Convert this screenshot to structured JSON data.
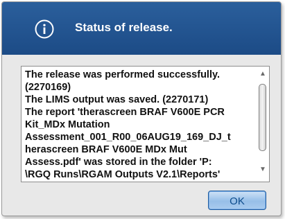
{
  "dialog": {
    "title": "Status of release.",
    "icon": "info-icon",
    "message_lines": [
      "The release was performed successfully.",
      "(2270169)",
      "The LIMS output was saved. (2270171)",
      "The report 'therascreen BRAF V600E PCR",
      "Kit_MDx Mutation",
      "Assessment_001_R00_06AUG19_169_DJ_t",
      "herascreen BRAF V600E MDx Mut",
      "Assess.pdf' was stored in the folder 'P:",
      "\\RGQ Runs\\RGAM Outputs V2.1\\Reports'"
    ],
    "ok_label": "OK"
  },
  "colors": {
    "title_bar": "#1f4f8c",
    "ok_button_text": "#0d4c8c"
  }
}
